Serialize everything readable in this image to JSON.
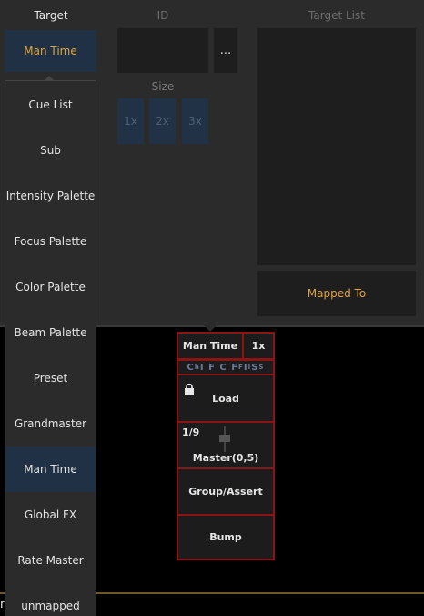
{
  "header": {
    "target": "Target",
    "id": "ID",
    "target_list": "Target List"
  },
  "target_button": {
    "label": "Man Time"
  },
  "id_field": {
    "value": ""
  },
  "id_browse": {
    "label": "..."
  },
  "size": {
    "label": "Size",
    "options": [
      "1x",
      "2x",
      "3x"
    ]
  },
  "target_list": {
    "items": []
  },
  "mapped_to": {
    "label": "Mapped To"
  },
  "dropdown": {
    "items": [
      {
        "label": "Cue List"
      },
      {
        "label": "Sub"
      },
      {
        "label": "Intensity Palette"
      },
      {
        "label": "Focus Palette"
      },
      {
        "label": "Color Palette"
      },
      {
        "label": "Beam Palette"
      },
      {
        "label": "Preset"
      },
      {
        "label": "Grandmaster"
      },
      {
        "label": "Man Time"
      },
      {
        "label": "Global FX"
      },
      {
        "label": "Rate Master"
      },
      {
        "label": "unmapped"
      }
    ],
    "selected": "Man Time"
  },
  "fader": {
    "name": "Man Time",
    "size": "1x",
    "flags": "C h I F C F B I B S B",
    "load_label": "Load",
    "index": "1/9",
    "master_label": "Master(0,5)",
    "group_label": "Group/Assert",
    "bump_label": "Bump"
  },
  "command_line": {
    "text": "r"
  },
  "colors": {
    "accent": "#e0a43c",
    "selected_bg": "#213145",
    "fader_border": "#8c1414"
  }
}
